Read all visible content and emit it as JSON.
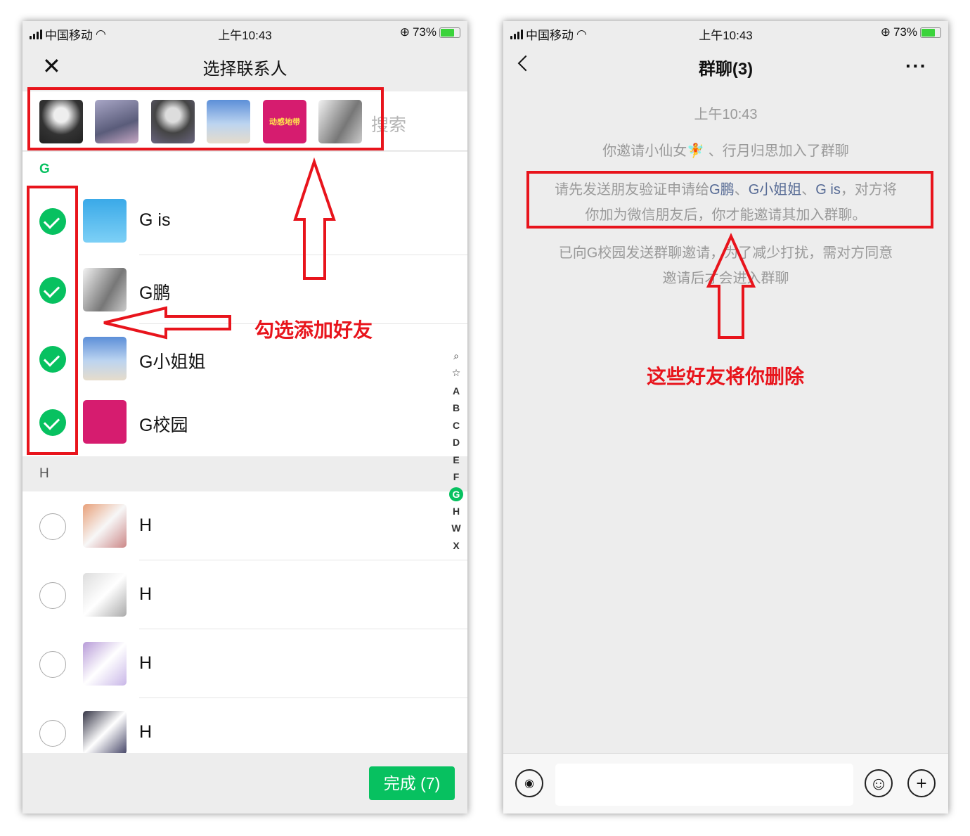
{
  "status": {
    "carrier": "中国移动",
    "time": "上午10:43",
    "battery": "73%",
    "battery_level": 0.73
  },
  "left": {
    "title": "选择联系人",
    "search_placeholder": "搜索",
    "selected_count": 6,
    "section_g": "G",
    "section_h": "H",
    "contacts_g": [
      {
        "name": "G is",
        "checked": true
      },
      {
        "name": "G鹏",
        "checked": true
      },
      {
        "name": "G小姐姐",
        "checked": true
      },
      {
        "name": "G校园",
        "checked": true
      }
    ],
    "contacts_h": [
      {
        "name": "H",
        "checked": false
      },
      {
        "name": "H",
        "checked": false
      },
      {
        "name": "H",
        "checked": false
      },
      {
        "name": "H",
        "checked": false
      }
    ],
    "index": [
      "A",
      "B",
      "C",
      "D",
      "E",
      "F",
      "G",
      "H",
      "W",
      "X"
    ],
    "index_active": "G",
    "done_button": "完成 (7)",
    "logo_text": "动感地带",
    "accent": "#07c160"
  },
  "right": {
    "title": "群聊(3)",
    "timestamp": "上午10:43",
    "msg1": "你邀请小仙女🧚 、行月归思加入了群聊",
    "msg2_prefix": "请先发送朋友验证申请给",
    "msg2_links": [
      "G鹏",
      "G小姐姐",
      "G is"
    ],
    "msg2_sep": "、",
    "msg2_suffix": "，对方将",
    "msg2_line2": "你加为微信朋友后，你才能邀请其加入群聊。",
    "msg3_line1": "已向G校园发送群聊邀请，为了减少打扰，需对方同意",
    "msg3_line2": "邀请后才会进入群聊"
  },
  "annotations": {
    "left": "勾选添加好友",
    "right": "这些好友将你删除",
    "color": "#e8141c"
  }
}
